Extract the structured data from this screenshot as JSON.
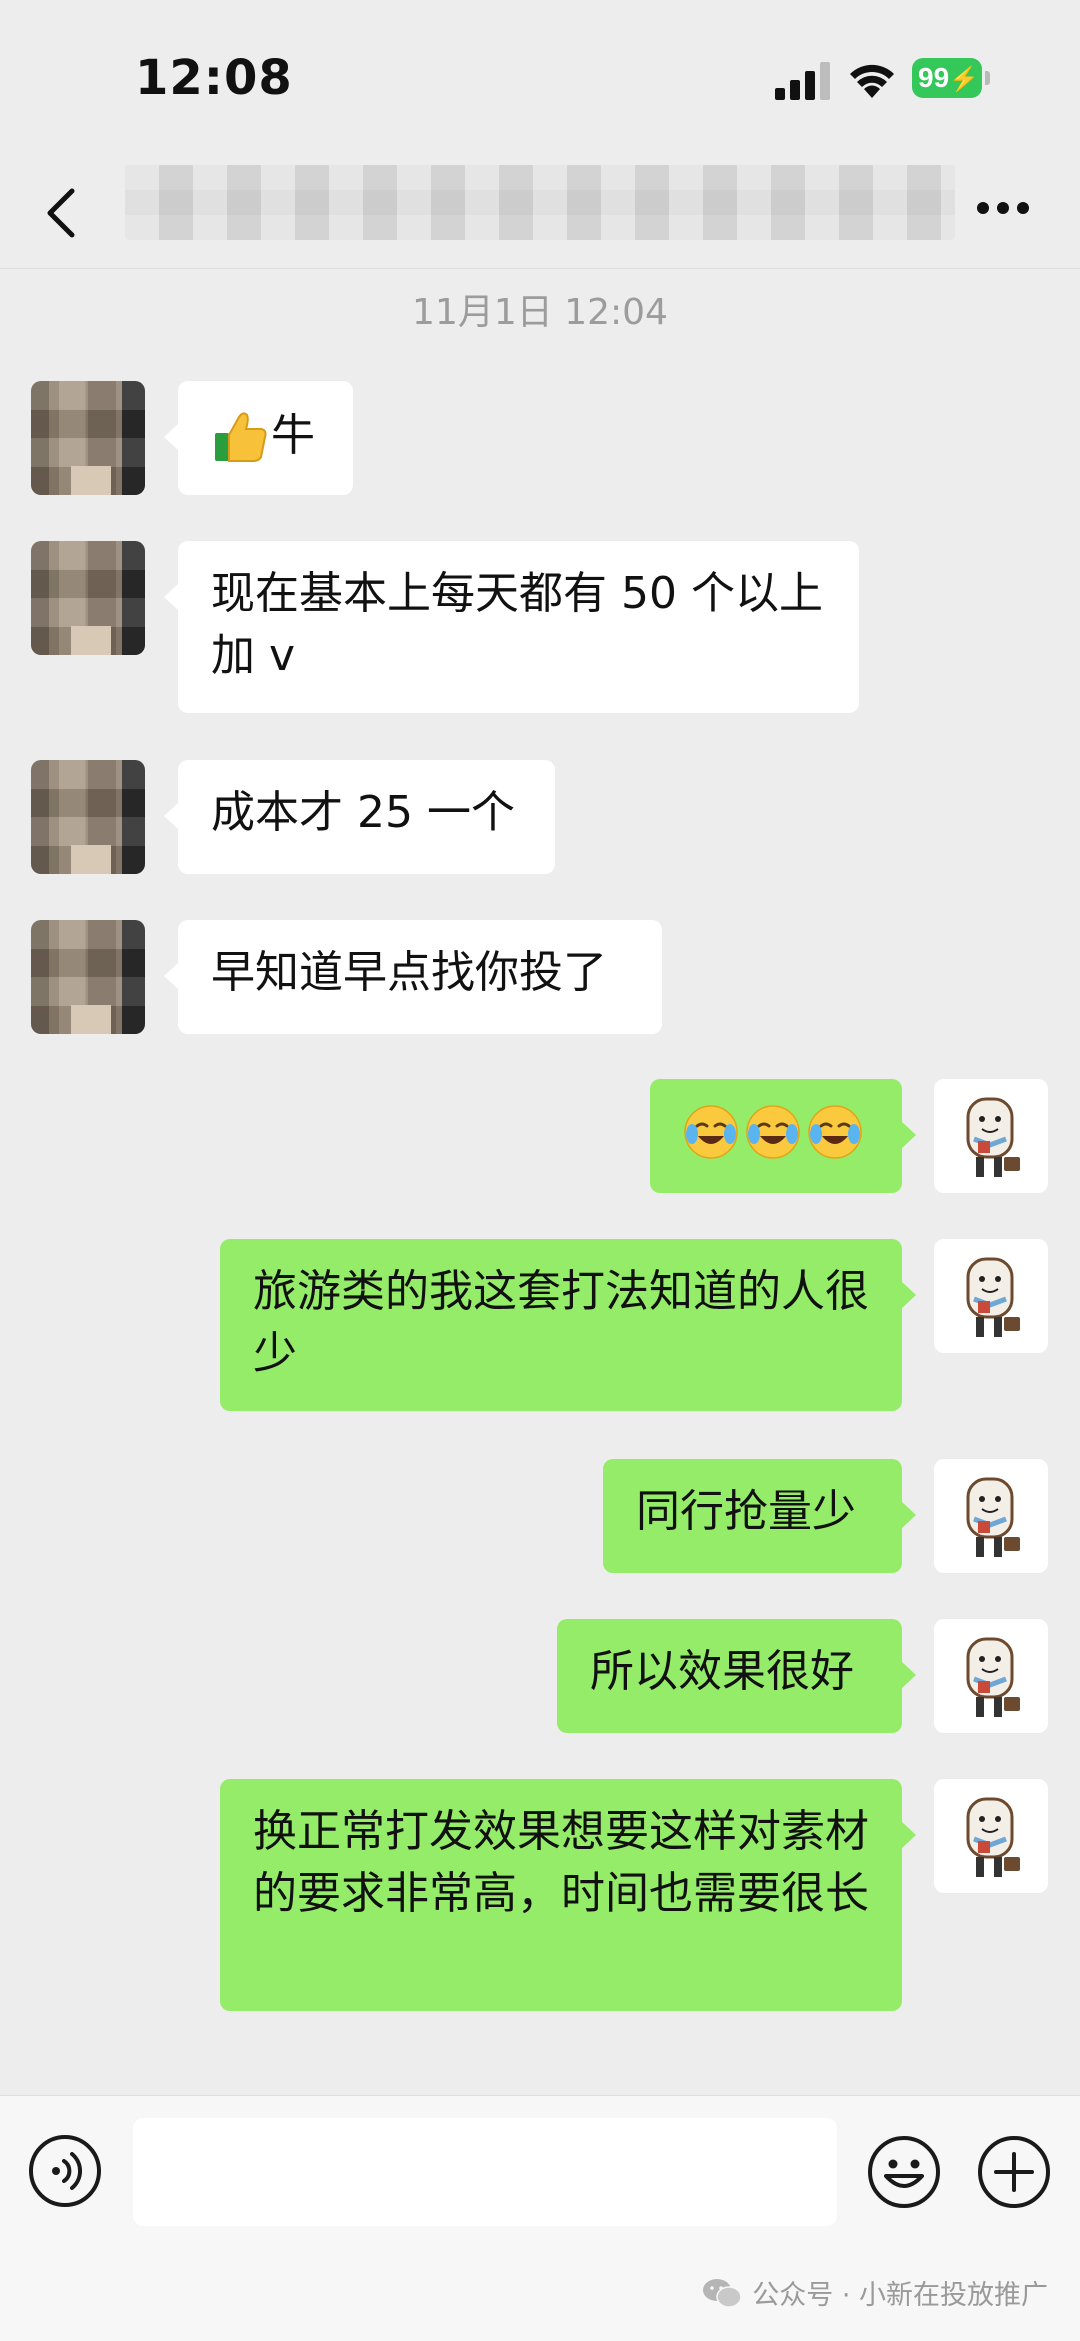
{
  "status_bar": {
    "time": "12:08",
    "battery": "99",
    "signal_icon": "cellular-signal-icon",
    "wifi_icon": "wifi-icon",
    "battery_color": "#34c759"
  },
  "nav": {
    "back_icon": "chevron-left-icon",
    "title_blurred": true,
    "more_icon": "ellipsis-icon"
  },
  "chat": {
    "timestamp": "11月1日 12:04",
    "messages": [
      {
        "side": "left",
        "emoji": "thumbs-up-icon",
        "text": "牛"
      },
      {
        "side": "left",
        "text": "现在基本上每天都有 50 个以上加 v"
      },
      {
        "side": "left",
        "text": "成本才 25 一个"
      },
      {
        "side": "left",
        "text": "早知道早点找你投了"
      },
      {
        "side": "right",
        "emoji": "crying-laughing-face-icon",
        "emoji_count": 3
      },
      {
        "side": "right",
        "text": "旅游类的我这套打法知道的人很少"
      },
      {
        "side": "right",
        "text": "同行抢量少"
      },
      {
        "side": "right",
        "text": "所以效果很好"
      },
      {
        "side": "right",
        "text": "换正常打发效果想要这样对素材的要求非常高，时间也需要很长"
      }
    ],
    "colors": {
      "background": "#ededed",
      "incoming_bubble": "#ffffff",
      "outgoing_bubble": "#95ec69",
      "timestamp": "#9c9c9c"
    }
  },
  "input_bar": {
    "voice_icon": "voice-input-icon",
    "text_value": "",
    "emoji_icon": "emoji-smile-icon",
    "plus_icon": "plus-circle-icon"
  },
  "watermark": {
    "text": "公众号 · 小新在投放推广",
    "icon": "wechat-logo-icon"
  }
}
